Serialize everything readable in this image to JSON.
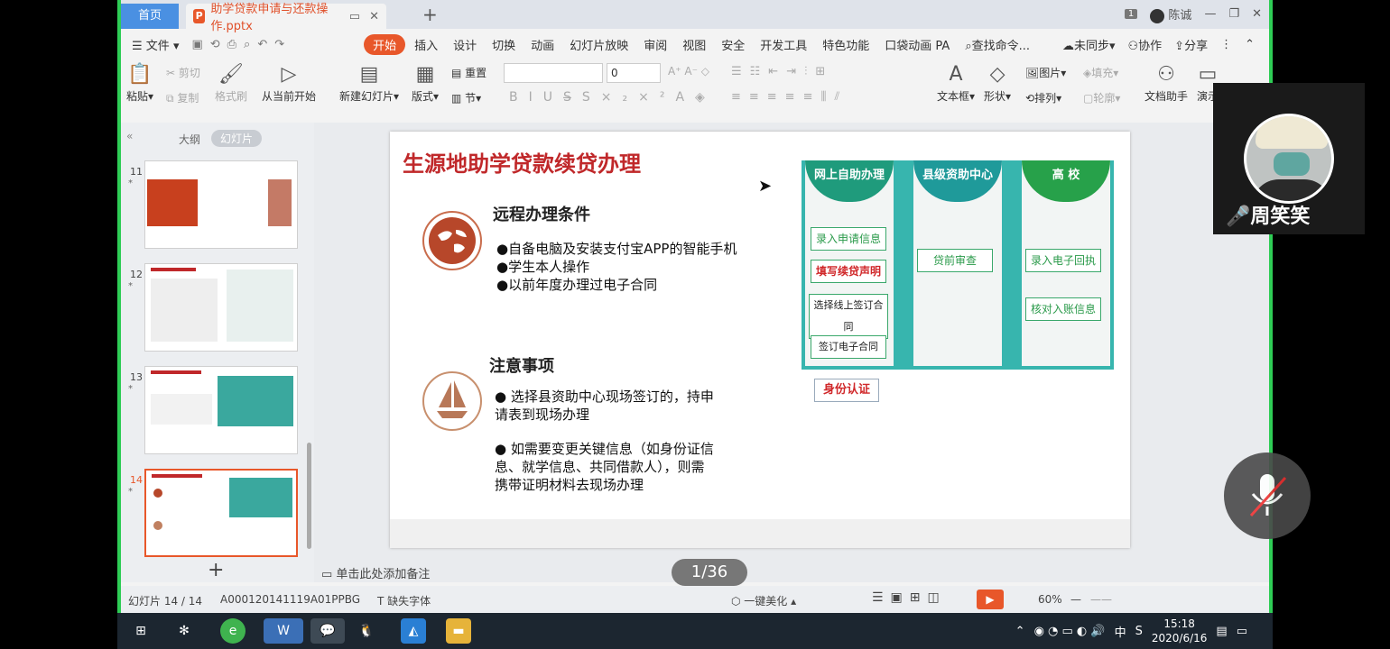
{
  "tabs": {
    "home": "首页",
    "doc": "助学贷款申请与还款操作.pptx",
    "page_badge": "1",
    "user": "陈诚"
  },
  "menu": {
    "file": "文件",
    "items": [
      "开始",
      "插入",
      "设计",
      "切换",
      "动画",
      "幻灯片放映",
      "审阅",
      "视图",
      "安全",
      "开发工具",
      "特色功能",
      "口袋动画 PA"
    ],
    "search": "查找命令...",
    "sync": "未同步",
    "collab": "协作",
    "share": "分享"
  },
  "ribbon": {
    "paste": "粘贴",
    "cut": "剪切",
    "copy": "复制",
    "format_painter": "格式刷",
    "from_current": "从当前开始",
    "new_slide": "新建幻灯片",
    "layout": "版式",
    "reset": "重置",
    "section": "节",
    "font_size": "0",
    "textbox": "文本框",
    "shape": "形状",
    "picture": "图片",
    "fill": "填充",
    "arrange": "排列",
    "outline": "轮廓",
    "doc_helper": "文档助手",
    "present": "演示"
  },
  "panel": {
    "outline": "大纲",
    "slides": "幻灯片",
    "thumbs": [
      "11",
      "12",
      "13",
      "14"
    ]
  },
  "slide": {
    "title": "生源地助学贷款续贷办理",
    "h_remote": "远程办理条件",
    "remote_items": [
      "●自备电脑及安装支付宝APP的智能手机",
      "●学生本人操作",
      "●以前年度办理过电子合同"
    ],
    "h_notice": "注意事项",
    "notice_1a": "● 选择县资助中心现场签订的，持申",
    "notice_1b": "请表到现场办理",
    "notice_2a": "● 如需要变更关键信息（如身份证信",
    "notice_2b": "息、就学信息、共同借款人），则需",
    "notice_2c": "携带证明材料去现场办理",
    "flow": {
      "col1": "网上自助办理",
      "col2": "县级资助中心",
      "col3": "高 校",
      "b1": "录入申请信息",
      "b2": "填写续贷声明",
      "b3": "选择线上签订合同",
      "b4": "签订电子合同",
      "b5": "贷前审查",
      "b6": "录入电子回执",
      "b7": "核对入账信息",
      "b8": "身份认证"
    }
  },
  "notes": "单击此处添加备注",
  "page_indicator": "1/36",
  "status": {
    "slide": "幻灯片 14 / 14",
    "id": "A000120141119A01PPBG",
    "font": "缺失字体",
    "beautify": "一键美化",
    "zoom": "60%"
  },
  "taskbar": {
    "time": "15:18",
    "date": "2020/6/16",
    "ime": "中"
  },
  "video": {
    "name": "周笑笑"
  }
}
